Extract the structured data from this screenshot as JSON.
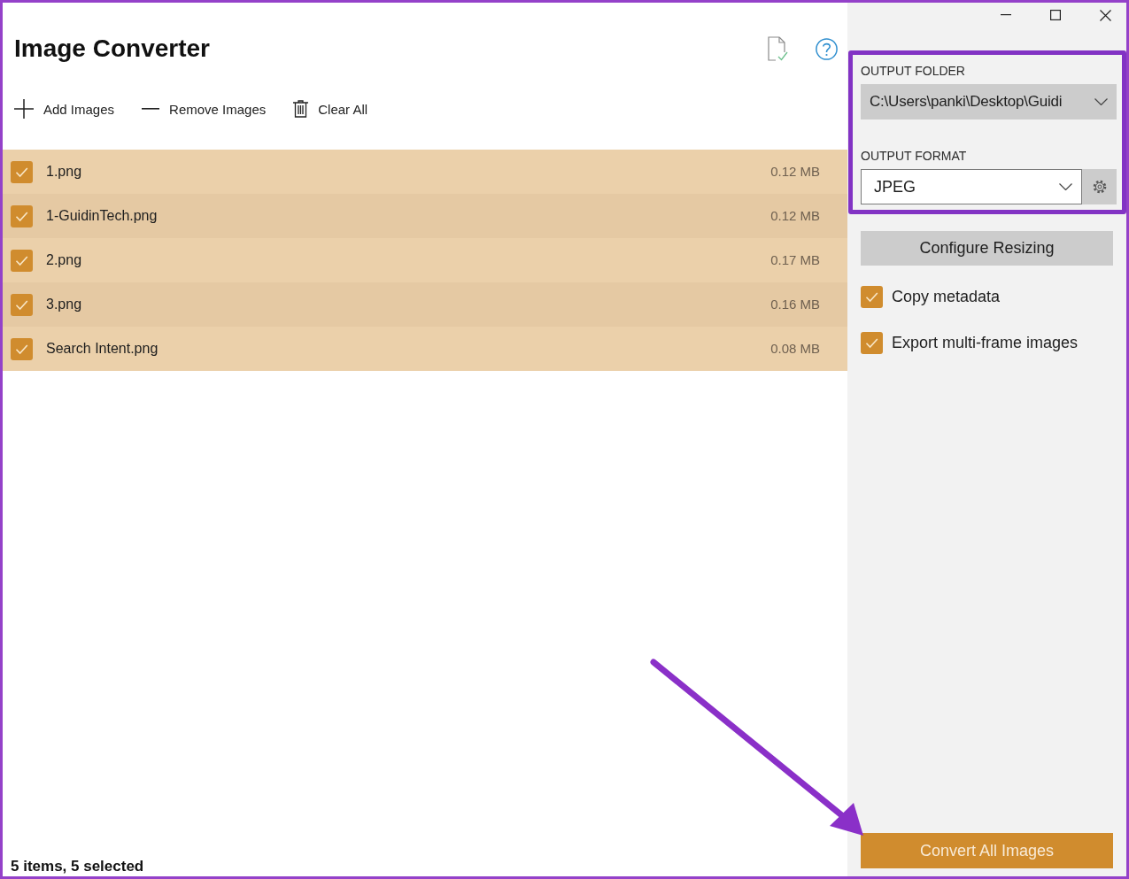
{
  "app": {
    "title": "Image Converter"
  },
  "toolbar": [
    {
      "kind": "add",
      "label": "Add Images"
    },
    {
      "kind": "remove",
      "label": "Remove Images"
    },
    {
      "kind": "clear",
      "label": "Clear All"
    }
  ],
  "files": [
    {
      "name": "1.png",
      "size": "0.12 MB",
      "checked": true,
      "selected": true
    },
    {
      "name": "1-GuidinTech.png",
      "size": "0.12 MB",
      "checked": true,
      "selected": true
    },
    {
      "name": "2.png",
      "size": "0.17 MB",
      "checked": true,
      "selected": true
    },
    {
      "name": "3.png",
      "size": "0.16 MB",
      "checked": true,
      "selected": true
    },
    {
      "name": "Search Intent.png",
      "size": "0.08 MB",
      "checked": true,
      "selected": true
    }
  ],
  "status_bar": "5 items, 5 selected",
  "settings": {
    "output_folder": {
      "label": "OUTPUT FOLDER",
      "value": "C:\\Users\\panki\\Desktop\\Guidi"
    },
    "output_format": {
      "label": "OUTPUT FORMAT",
      "value": "JPEG"
    },
    "configure_button": "Configure Resizing",
    "options": [
      {
        "label": "Copy metadata",
        "checked": true
      },
      {
        "label": "Export multi-frame images",
        "checked": true
      }
    ],
    "convert_button": "Convert All Images"
  },
  "annotations": [
    {
      "kind": "border"
    },
    {
      "kind": "frame"
    },
    {
      "kind": "arrow"
    }
  ]
}
